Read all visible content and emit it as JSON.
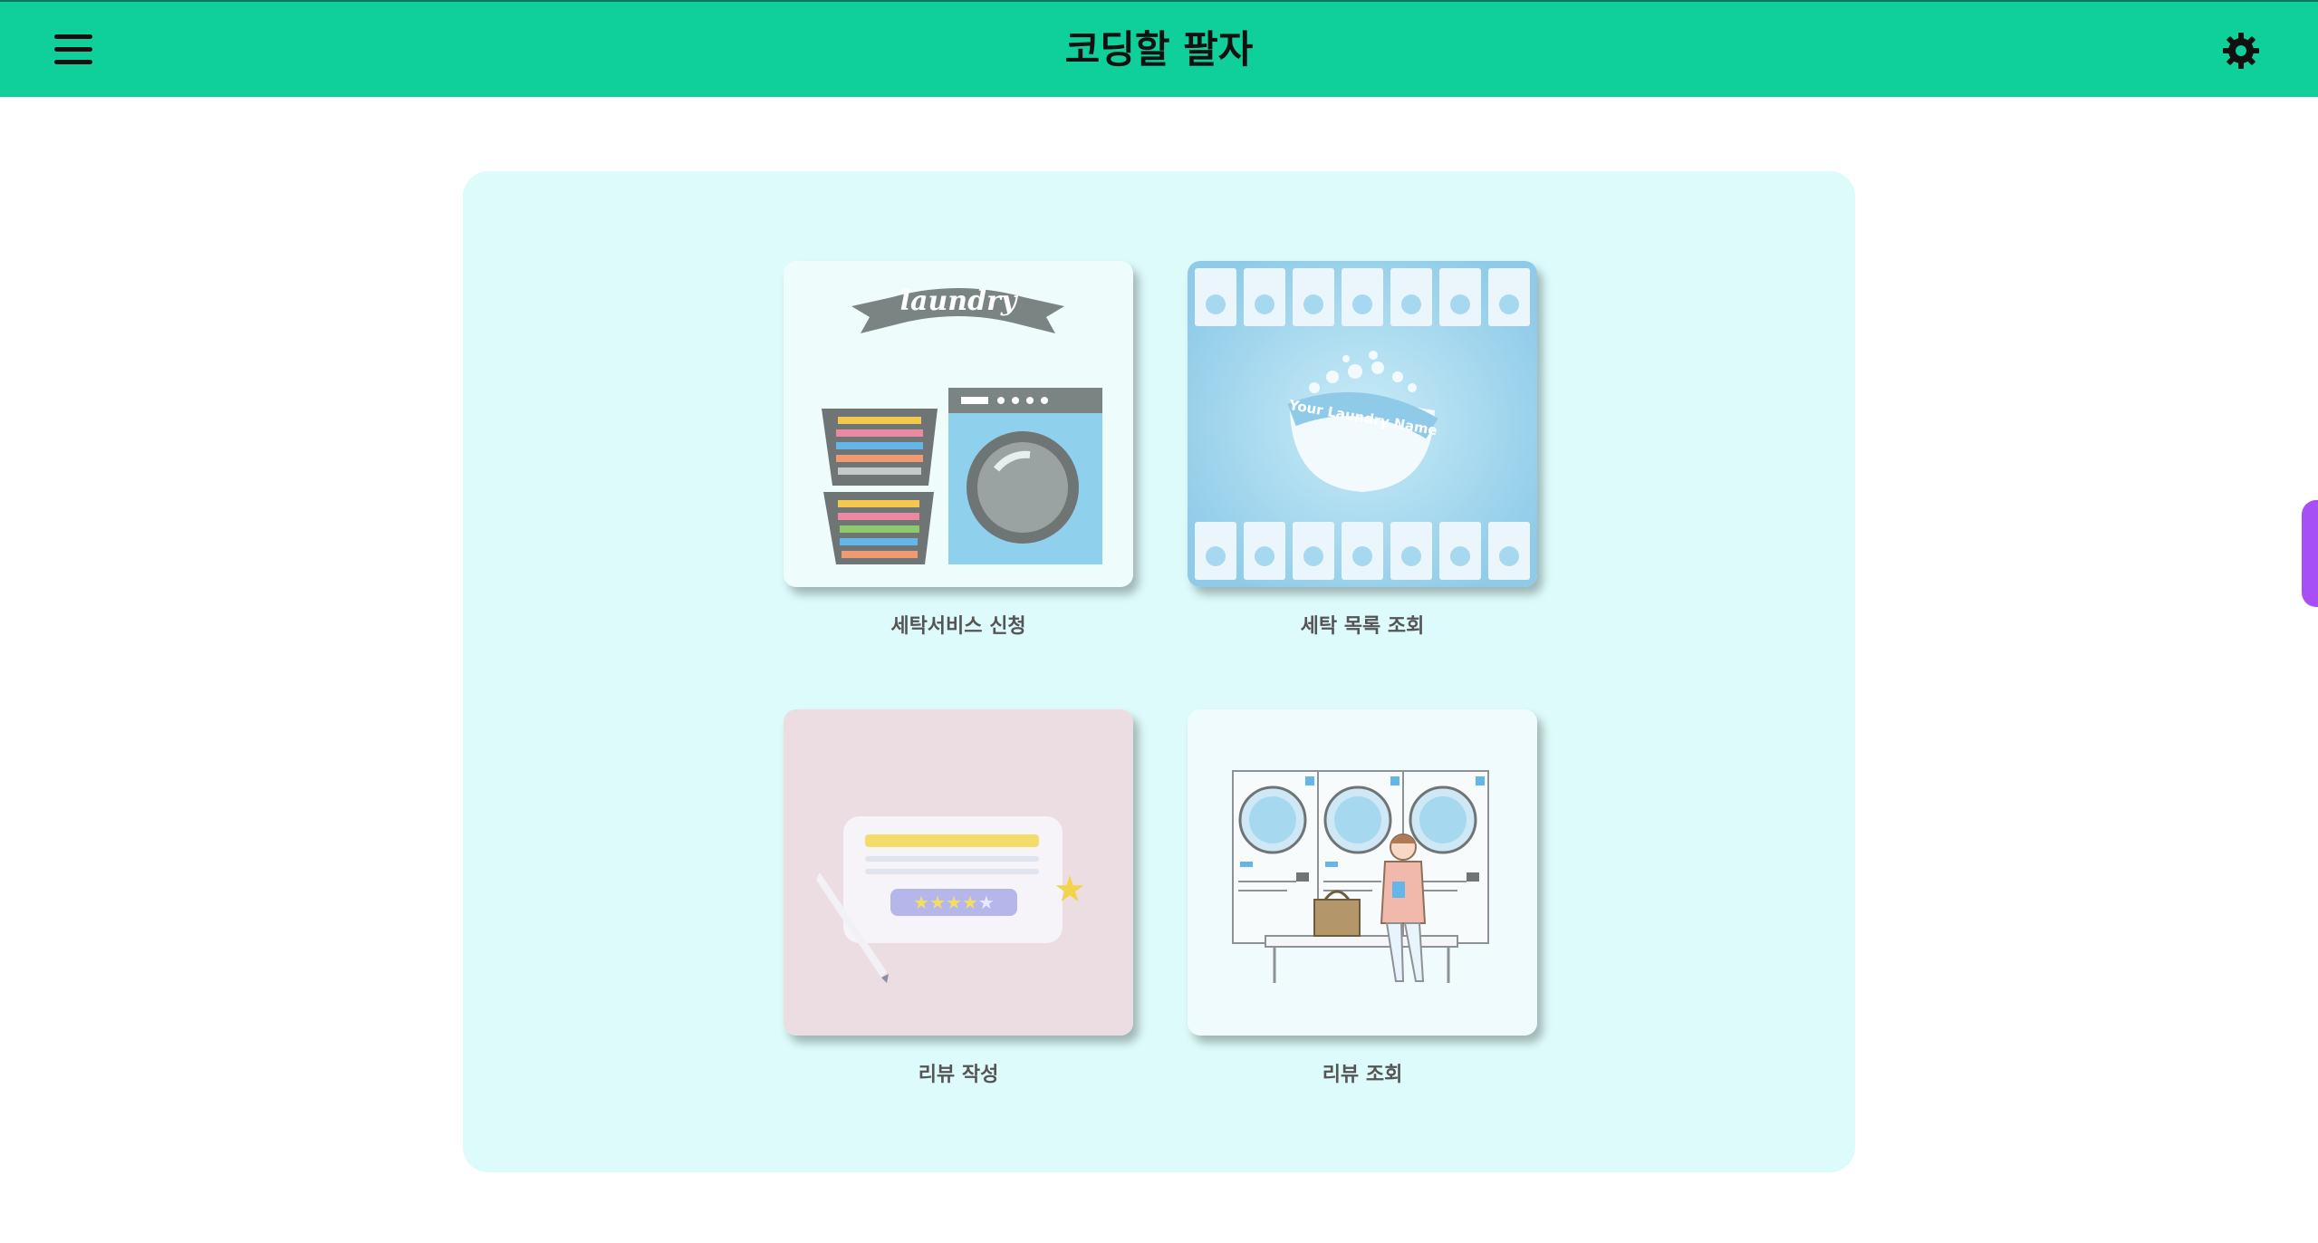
{
  "header": {
    "title": "코딩할 팔자",
    "menu_icon": "hamburger-menu-icon",
    "settings_icon": "gear-icon"
  },
  "colors": {
    "header_bg": "#0fcf9a",
    "panel_bg": "#dcfbfa",
    "side_tab": "#a74ff5"
  },
  "cards": [
    {
      "label": "세탁서비스 신청",
      "image_text": "laundry",
      "icon": "laundry-basket-washer-illustration"
    },
    {
      "label": "세탁 목록 조회",
      "image_text": "Your Laundry Name",
      "icon": "laundromat-washers-illustration"
    },
    {
      "label": "리뷰 작성",
      "icon": "review-stars-card-illustration"
    },
    {
      "label": "리뷰 조회",
      "icon": "person-waiting-laundromat-illustration"
    }
  ]
}
